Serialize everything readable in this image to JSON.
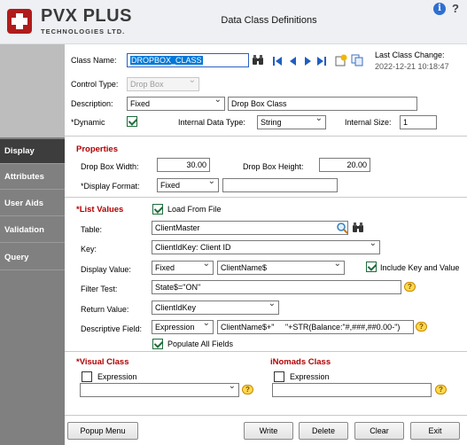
{
  "header": {
    "logo_main": "PVX PLUS",
    "logo_sub": "TECHNOLOGIES LTD.",
    "title": "Data Class Definitions"
  },
  "sidebar": {
    "items": [
      {
        "label": "Display",
        "active": true
      },
      {
        "label": "Attributes",
        "active": false
      },
      {
        "label": "User Aids",
        "active": false
      },
      {
        "label": "Validation",
        "active": false
      },
      {
        "label": "Query",
        "active": false
      }
    ]
  },
  "general": {
    "class_name_label": "Class Name:",
    "class_name_value": "DROPBOX_CLASS",
    "last_change_label": "Last Class Change:",
    "last_change_value": "2022-12-21 10:18:47",
    "control_type_label": "Control Type:",
    "control_type_value": "Drop Box",
    "description_label": "Description:",
    "description_mode": "Fixed",
    "description_value": "Drop Box Class",
    "dynamic_label": "*Dynamic",
    "internal_type_label": "Internal Data Type:",
    "internal_type_value": "String",
    "internal_size_label": "Internal Size:",
    "internal_size_value": "1"
  },
  "properties": {
    "heading": "Properties",
    "width_label": "Drop Box Width:",
    "width_value": "30.00",
    "height_label": "Drop Box Height:",
    "height_value": "20.00",
    "display_format_label": "*Display Format:",
    "display_format_value": "Fixed",
    "display_format_text": ""
  },
  "list_values": {
    "heading": "*List Values",
    "load_from_file_label": "Load From File",
    "table_label": "Table:",
    "table_value": "ClientMaster",
    "key_label": "Key:",
    "key_value": "ClientIdKey: Client ID",
    "display_value_label": "Display Value:",
    "display_value_mode": "Fixed",
    "display_value_field": "ClientName$",
    "include_key_label": "Include Key and Value",
    "filter_label": "Filter Test:",
    "filter_value": "State$=\"ON\"",
    "return_label": "Return Value:",
    "return_value": "ClientIdKey",
    "descriptive_label": "Descriptive Field:",
    "descriptive_mode": "Expression",
    "descriptive_value": "ClientName$+\"     \"+STR(Balance:\"#,###,##0.00-\")",
    "populate_label": "Populate All Fields"
  },
  "visual_class": {
    "heading": "*Visual Class",
    "expression_label": "Expression",
    "value": ""
  },
  "inomads_class": {
    "heading": "iNomads Class",
    "expression_label": "Expression",
    "value": ""
  },
  "buttons": {
    "popup_menu": "Popup Menu",
    "write": "Write",
    "delete": "Delete",
    "clear": "Clear",
    "exit": "Exit"
  },
  "colors": {
    "section_heading": "#b00000",
    "sidebar_active": "#3d3d3d",
    "sidebar_bg": "#808080",
    "selection": "#0078d7",
    "nav_arrows": "#1e5fbf"
  }
}
